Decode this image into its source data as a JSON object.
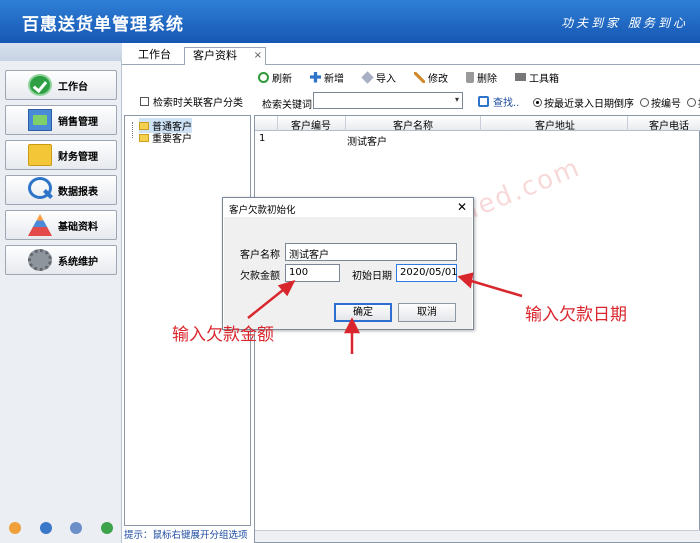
{
  "header": {
    "title": "百惠送货单管理系统",
    "slogan": "功夫到家 服务到心"
  },
  "nav": [
    {
      "label": "工作台",
      "icon": "check-circle-icon"
    },
    {
      "label": "销售管理",
      "icon": "sales-icon"
    },
    {
      "label": "财务管理",
      "icon": "folder-icon"
    },
    {
      "label": "数据报表",
      "icon": "magnifier-icon"
    },
    {
      "label": "基础资料",
      "icon": "base-data-icon"
    },
    {
      "label": "系统维护",
      "icon": "gear-icon"
    }
  ],
  "tabs": [
    {
      "label": "工作台"
    },
    {
      "label": "客户资料"
    }
  ],
  "tab_close": "×",
  "toolbar": [
    {
      "label": "刷新",
      "icon": "refresh-icon",
      "color": "#2e9a3a"
    },
    {
      "label": "新增",
      "icon": "add-icon",
      "color": "#2e74c9"
    },
    {
      "label": "导入",
      "icon": "import-icon",
      "color": "#8b8b9b"
    },
    {
      "label": "修改",
      "icon": "edit-icon",
      "color": "#d08a2a"
    },
    {
      "label": "删除",
      "icon": "delete-icon",
      "color": "#888888"
    },
    {
      "label": "工具箱",
      "icon": "toolbox-icon",
      "color": "#6b6b6b"
    }
  ],
  "search_by_category": "检索时关联客户分类",
  "tree": [
    {
      "label": "普通客户"
    },
    {
      "label": "重要客户"
    }
  ],
  "hint": "提示：鼠标右键展开分组选项",
  "search": {
    "label": "检索关键词",
    "value": "",
    "button": "查找..",
    "dropdown": "▾"
  },
  "sort_options": [
    {
      "label": "按最近录入日期倒序",
      "checked": true
    },
    {
      "label": "按编号",
      "checked": false
    },
    {
      "label": "按",
      "checked": false
    }
  ],
  "grid": {
    "columns": [
      "客户编号",
      "客户名称",
      "客户地址",
      "客户电话"
    ],
    "rows": [
      {
        "index": "1",
        "name": "测试客户"
      }
    ]
  },
  "watermark": "www.haoded.com",
  "dialog": {
    "title": "客户欠款初始化",
    "close": "✕",
    "name_label": "客户名称",
    "name_value": "测试客户",
    "amount_label": "欠款金额",
    "amount_value": "100",
    "date_label": "初始日期",
    "date_value": "2020/05/01",
    "ok": "确定",
    "cancel": "取消"
  },
  "annotations": {
    "amount": "输入欠款金额",
    "date": "输入欠款日期"
  },
  "colors": {
    "header": "#1f6cc9",
    "annotation": "#d9262c",
    "focus": "#2c7be5"
  }
}
